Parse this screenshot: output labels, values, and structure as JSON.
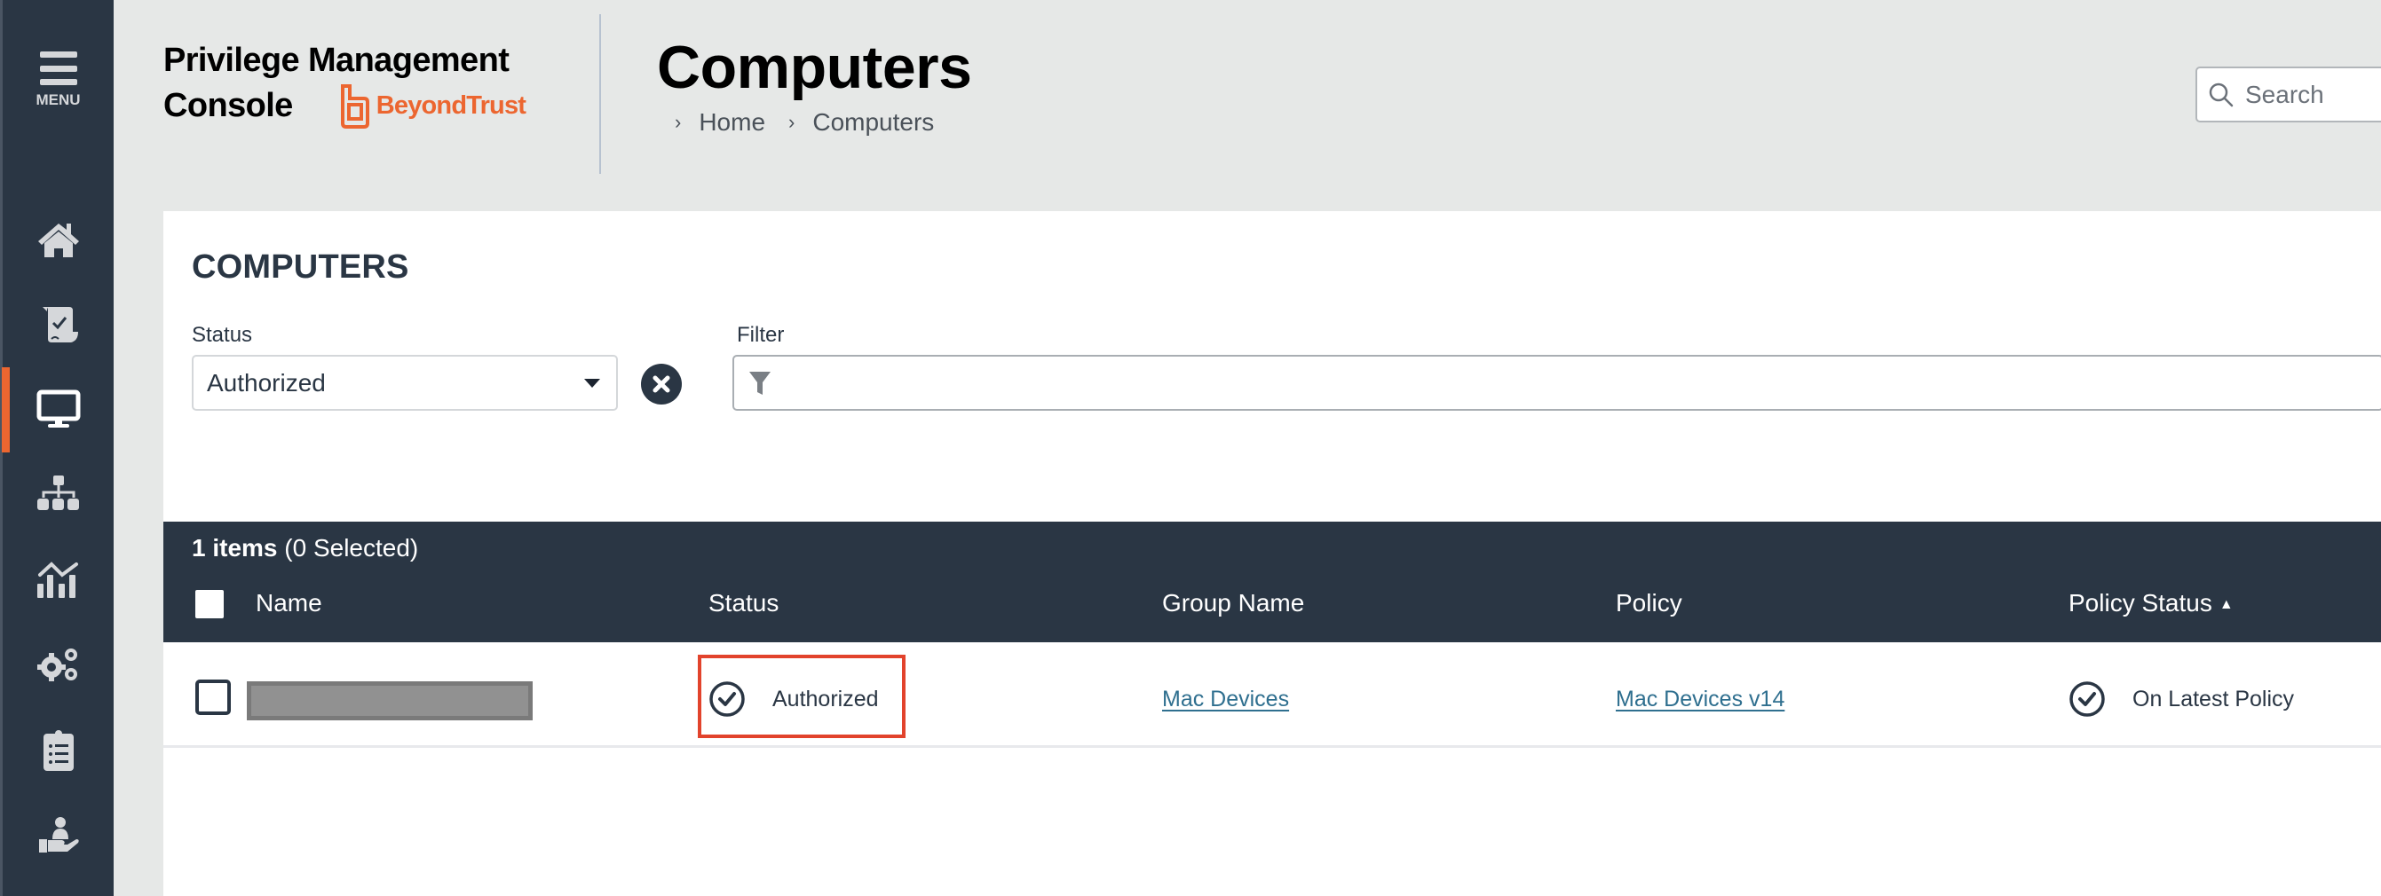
{
  "sidebar": {
    "menu_label": "MENU",
    "items": [
      {
        "name": "home",
        "icon": "home-icon",
        "active": false
      },
      {
        "name": "policies",
        "icon": "scroll-check-icon",
        "active": false
      },
      {
        "name": "computers",
        "icon": "monitor-icon",
        "active": true
      },
      {
        "name": "groups",
        "icon": "sitemap-icon",
        "active": false
      },
      {
        "name": "analytics",
        "icon": "chart-line-icon",
        "active": false
      },
      {
        "name": "configuration",
        "icon": "gears-icon",
        "active": false
      },
      {
        "name": "activity-audits",
        "icon": "clipboard-list-icon",
        "active": false
      },
      {
        "name": "users",
        "icon": "hand-user-icon",
        "active": false
      }
    ],
    "accent_color": "#ec6630"
  },
  "header": {
    "brand_line1": "Privilege Management",
    "brand_line2": "Console",
    "logo_text": "BeyondTrust",
    "page_title": "Computers",
    "breadcrumb": [
      "Home",
      "Computers"
    ],
    "search_placeholder": "Search"
  },
  "main": {
    "section_title": "COMPUTERS",
    "status_filter": {
      "label": "Status",
      "value": "Authorized"
    },
    "filter": {
      "label": "Filter",
      "value": ""
    },
    "table": {
      "count_bold": "1 items",
      "count_rest": " (0 Selected)",
      "columns": [
        "Name",
        "Status",
        "Group Name",
        "Policy",
        "Policy Status"
      ],
      "sort": {
        "column": "Policy Status",
        "direction": "ascending"
      },
      "rows": [
        {
          "name": "[redacted]",
          "status": "Authorized",
          "group_name": "Mac Devices",
          "policy": "Mac Devices v14",
          "policy_status": "On Latest Policy",
          "selected": false
        }
      ]
    },
    "highlight_color": "#e2432c"
  }
}
